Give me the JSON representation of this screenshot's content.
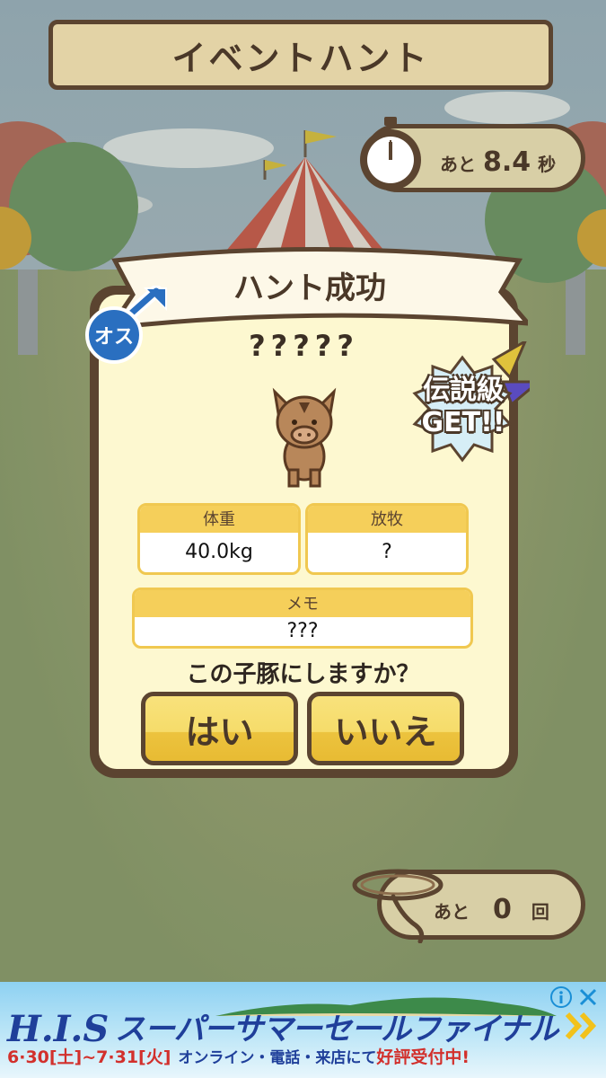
{
  "title": "イベントハント",
  "timer": {
    "prefix": "あと",
    "value": "8.4",
    "unit": "秒"
  },
  "result": {
    "title": "ハント成功",
    "gender": "オス",
    "species": "?????",
    "legend_line1": "伝説級",
    "legend_line2": "GET!!",
    "stats": {
      "weight": {
        "label": "体重",
        "value": "40.0kg"
      },
      "grazing": {
        "label": "放牧",
        "value": "?"
      },
      "memo": {
        "label": "メモ",
        "value": "???"
      }
    },
    "question": "この子豚にしますか？",
    "yes": "はい",
    "no": "いいえ"
  },
  "remaining": {
    "prefix": "あと",
    "value": "0",
    "unit": "回"
  },
  "ad": {
    "brand": "H.I.S",
    "headline": "スーパーサマーセールファイナル",
    "dates": "6·30[土]~7·31[火]",
    "text_plain": "オンライン・電話・来店にて",
    "text_highlight": "好評受付中!"
  },
  "colors": {
    "border": "#5b4430",
    "board": "#e3d3a6",
    "panel_bg": "#fdf8d0",
    "button": "#f6dc6a",
    "ad_blue": "#1f3f9a",
    "ad_red": "#d2302c"
  }
}
